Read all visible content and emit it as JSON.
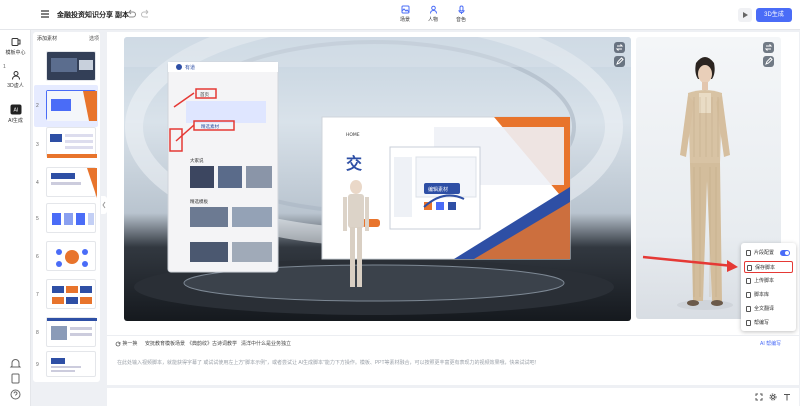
{
  "header": {
    "doc_title": "金融投资知识分享 副本",
    "tools": [
      {
        "label": "场景",
        "icon": "scene-icon"
      },
      {
        "label": "人物",
        "icon": "person-icon"
      },
      {
        "label": "音色",
        "icon": "microphone-icon"
      }
    ],
    "generate_label": "3D生成"
  },
  "rail": {
    "items": [
      {
        "label": "模板中心",
        "icon": "template-icon"
      },
      {
        "label": "3D虚人",
        "icon": "avatar-icon"
      },
      {
        "label": "AI生成",
        "icon": "ai-icon"
      }
    ]
  },
  "slides": {
    "add_label": "添加素材",
    "batch_label": "选项",
    "numbers": [
      "1",
      "2",
      "3",
      "4",
      "5",
      "6",
      "7",
      "8",
      "9"
    ]
  },
  "scene": {
    "app_logo_text": "有道",
    "screen_tab": "首页",
    "screen_tab2": "HOME",
    "screen_btn": "精选素材",
    "screen_banner": "编辑素材",
    "screen_section1": "大家说",
    "screen_section2": "精选模板",
    "screen_big_char": "交"
  },
  "popup": {
    "items": [
      {
        "label": "片段配置",
        "icon": "segment-icon",
        "toggle": true
      },
      {
        "label": "保存脚本",
        "icon": "save-icon",
        "highlight": true
      },
      {
        "label": "上传脚本",
        "icon": "upload-icon"
      },
      {
        "label": "脚本库",
        "icon": "library-icon"
      },
      {
        "label": "全文翻译",
        "icon": "translate-icon"
      },
      {
        "label": "帮编写",
        "icon": "ai-write-icon"
      }
    ]
  },
  "script": {
    "toolbar": [
      "换一换",
      "安抚教育模板场景",
      "《典韵纹》古诗词教学",
      "清洋中什么是业务独立"
    ],
    "ai_label": "AI 帮编写",
    "placeholder": "在此处输入视频脚本，就能获得字幕了 或试试使用左上方\"脚本示例\"，或者尝试让 AI生成脚本\"能力下方操作。模板、PPT等素材融合，可以按照更丰富更有表现力的视频效果哦，快来试试吧！"
  },
  "colors": {
    "accent": "#4a6cf7",
    "highlight": "#e53935",
    "orange": "#e8742c"
  }
}
